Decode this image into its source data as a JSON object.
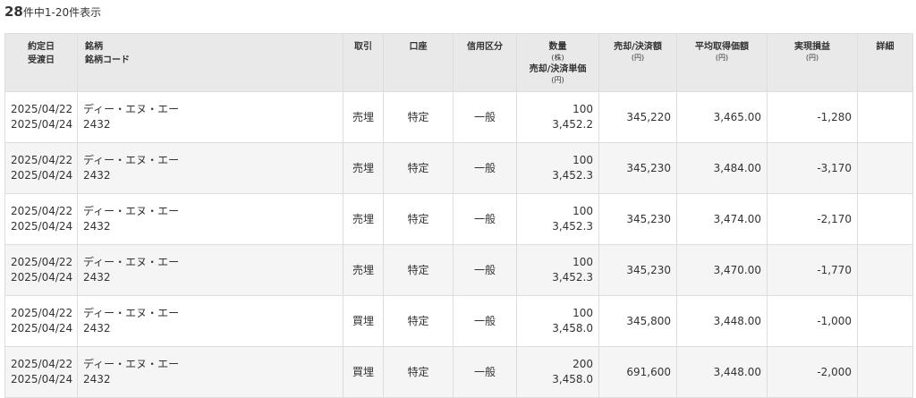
{
  "summary": {
    "total": "28",
    "range_text": "件中1-20件表示"
  },
  "headers": {
    "date": {
      "line1": "約定日",
      "line2": "受渡日"
    },
    "stock": {
      "line1": "銘柄",
      "line2": "銘柄コード"
    },
    "trade": "取引",
    "account": "口座",
    "credit": "信用区分",
    "quantity": {
      "line1": "数量",
      "unit1": "(株)",
      "line2": "売却/決済単価",
      "unit2": "(円)"
    },
    "amount": {
      "line1": "売却/決済額",
      "unit": "(円)"
    },
    "avg": {
      "line1": "平均取得価額",
      "unit": "(円)"
    },
    "pl": {
      "line1": "実現損益",
      "unit": "(円)"
    },
    "detail": "詳細"
  },
  "rows": [
    {
      "trade_date": "2025/04/22",
      "settle_date": "2025/04/24",
      "name": "ディー・エヌ・エー",
      "code": "2432",
      "trade": "売埋",
      "account": "特定",
      "credit": "一般",
      "qty": "100",
      "price": "3,452.2",
      "amount": "345,220",
      "avg": "3,465.00",
      "pl": "-1,280"
    },
    {
      "trade_date": "2025/04/22",
      "settle_date": "2025/04/24",
      "name": "ディー・エヌ・エー",
      "code": "2432",
      "trade": "売埋",
      "account": "特定",
      "credit": "一般",
      "qty": "100",
      "price": "3,452.3",
      "amount": "345,230",
      "avg": "3,484.00",
      "pl": "-3,170"
    },
    {
      "trade_date": "2025/04/22",
      "settle_date": "2025/04/24",
      "name": "ディー・エヌ・エー",
      "code": "2432",
      "trade": "売埋",
      "account": "特定",
      "credit": "一般",
      "qty": "100",
      "price": "3,452.3",
      "amount": "345,230",
      "avg": "3,474.00",
      "pl": "-2,170"
    },
    {
      "trade_date": "2025/04/22",
      "settle_date": "2025/04/24",
      "name": "ディー・エヌ・エー",
      "code": "2432",
      "trade": "売埋",
      "account": "特定",
      "credit": "一般",
      "qty": "100",
      "price": "3,452.3",
      "amount": "345,230",
      "avg": "3,470.00",
      "pl": "-1,770"
    },
    {
      "trade_date": "2025/04/22",
      "settle_date": "2025/04/24",
      "name": "ディー・エヌ・エー",
      "code": "2432",
      "trade": "買埋",
      "account": "特定",
      "credit": "一般",
      "qty": "100",
      "price": "3,458.0",
      "amount": "345,800",
      "avg": "3,448.00",
      "pl": "-1,000"
    },
    {
      "trade_date": "2025/04/22",
      "settle_date": "2025/04/24",
      "name": "ディー・エヌ・エー",
      "code": "2432",
      "trade": "買埋",
      "account": "特定",
      "credit": "一般",
      "qty": "200",
      "price": "3,458.0",
      "amount": "691,600",
      "avg": "3,448.00",
      "pl": "-2,000"
    }
  ],
  "colors": {
    "header_bg": "#e9e9e9",
    "row_alt_bg": "#f5f5f5",
    "profit_loss": "#2e8b00",
    "border": "#dddddd"
  }
}
